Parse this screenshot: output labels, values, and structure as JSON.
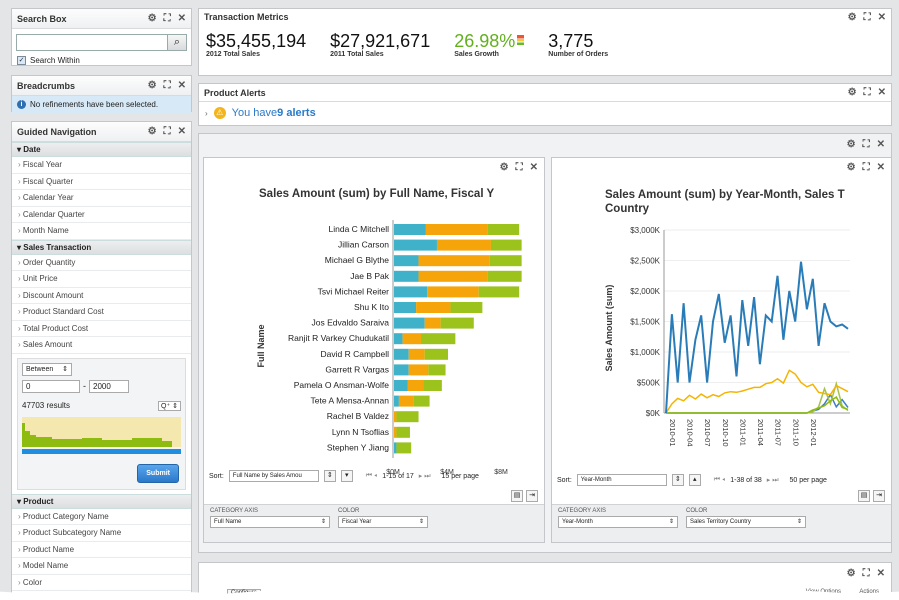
{
  "search": {
    "title": "Search Box",
    "within_label": "Search Within"
  },
  "breadcrumbs": {
    "title": "Breadcrumbs",
    "message": "No refinements have been selected."
  },
  "guided": {
    "title": "Guided Navigation",
    "date_label": "Date",
    "date_items": [
      "Fiscal Year",
      "Fiscal Quarter",
      "Calendar Year",
      "Calendar Quarter",
      "Month Name"
    ],
    "sales_label": "Sales Transaction",
    "sales_items": [
      "Order Quantity",
      "Unit Price",
      "Discount Amount",
      "Product Standard Cost",
      "Total Product Cost",
      "Sales Amount"
    ],
    "range_op": "Between",
    "range_from": "0",
    "range_to": "2000",
    "results": "47703 results",
    "submit": "Submit",
    "product_label": "Product",
    "product_items": [
      "Product Category Name",
      "Product Subcategory Name",
      "Product Name",
      "Model Name",
      "Color"
    ]
  },
  "metrics": {
    "title": "Transaction Metrics",
    "items": [
      {
        "value": "$35,455,194",
        "label": "2012 Total Sales"
      },
      {
        "value": "$27,921,671",
        "label": "2011 Total Sales"
      },
      {
        "value": "26.98%",
        "label": "Sales Growth"
      },
      {
        "value": "3,775",
        "label": "Number of Orders"
      }
    ]
  },
  "alerts": {
    "title": "Product Alerts",
    "prefix": "You have ",
    "count": "9 alerts"
  },
  "bar": {
    "sort_label": "Sort:",
    "sort_value": "Full Name by Sales Amou",
    "pager": "1-15 of 17",
    "per_page": "15 per page",
    "cat_axis_label": "CATEGORY AXIS",
    "cat_axis_value": "Full Name",
    "color_label": "COLOR",
    "color_value": "Fiscal Year"
  },
  "line": {
    "sort_label": "Sort:",
    "sort_value": "Year-Month",
    "pager": "1-38 of 38",
    "per_page": "50 per page",
    "cat_axis_label": "CATEGORY AXIS",
    "cat_axis_value": "Year-Month",
    "color_label": "COLOR",
    "color_value": "Sales Territory Country"
  },
  "bottom": {
    "tab": "Configure",
    "right": "View Options",
    "actions": "Actions"
  },
  "colors": {
    "teal": "#3fb1c9",
    "orange": "#f5a50a",
    "green": "#9bc31c",
    "blue": "#2a7cb8",
    "link": "#2a7ac8",
    "growth": "#62b01e"
  },
  "chart_data": [
    {
      "type": "bar",
      "title": "Sales Amount (sum) by Full Name, Fiscal Y",
      "ylabel": "Full Name",
      "orientation": "horizontal",
      "stacked": true,
      "categories": [
        "Linda C Mitchell",
        "Jillian  Carson",
        "Michael G Blythe",
        "Jae B Pak",
        "Tsvi Michael Reiter",
        "Shu K Ito",
        "Jos Edvaldo Saraiva",
        "Ranjit R Varkey Chudukatil",
        "David R Campbell",
        "Garrett R Vargas",
        "Pamela O Ansman-Wolfe",
        "Tete A Mensa-Annan",
        "Rachel B Valdez",
        "Lynn N Tsoflias",
        "Stephen Y Jiang"
      ],
      "series": [
        {
          "values": [
            1.3,
            1.75,
            1.0,
            1.0,
            1.35,
            0.9,
            1.25,
            0.35,
            0.6,
            0.6,
            0.55,
            0.2,
            0,
            0,
            0.1
          ]
        },
        {
          "values": [
            2.5,
            2.2,
            2.9,
            2.8,
            2.1,
            1.4,
            0.65,
            0.75,
            0.65,
            0.8,
            0.65,
            0.6,
            0.1,
            0.1,
            0
          ]
        },
        {
          "values": [
            1.3,
            1.25,
            1.3,
            1.4,
            1.65,
            1.3,
            1.35,
            1.4,
            0.95,
            0.7,
            0.75,
            0.65,
            0.9,
            0.55,
            0.6
          ]
        }
      ],
      "xticks": [
        "$0M",
        "$4M",
        "$8M"
      ],
      "xlim": [
        0,
        9
      ]
    },
    {
      "type": "line",
      "title": "Sales Amount (sum) by Year-Month, Sales T Country",
      "ylabel": "Sales Amount (sum)",
      "yticks": [
        "$0K",
        "$500K",
        "$1,000K",
        "$1,500K",
        "$2,000K",
        "$2,500K",
        "$3,000K"
      ],
      "ylim": [
        0,
        3000
      ],
      "xticks": [
        "2010-01",
        "2010-04",
        "2010-07",
        "2010-10",
        "2011-01",
        "2011-04",
        "2011-07",
        "2011-10",
        "2012-01"
      ],
      "series": [
        {
          "values": [
            0,
            1620,
            500,
            1800,
            500,
            1200,
            1600,
            500,
            1500,
            1950,
            1150,
            1600,
            600,
            1850,
            1100,
            1900,
            800,
            1600,
            1500,
            2250,
            1200,
            2000,
            1500,
            2480,
            1700,
            2200,
            1100,
            1800,
            1500,
            1420,
            1450,
            1380
          ]
        },
        {
          "values": [
            0,
            150,
            240,
            200,
            290,
            230,
            310,
            250,
            300,
            270,
            330,
            350,
            340,
            360,
            390,
            420,
            420,
            480,
            500,
            560,
            490,
            700,
            640,
            500,
            430,
            470,
            340,
            320,
            300,
            450,
            400,
            350
          ]
        },
        {
          "values": [
            0,
            0,
            0,
            0,
            0,
            0,
            0,
            0,
            0,
            0,
            0,
            0,
            0,
            0,
            0,
            0,
            0,
            0,
            0,
            0,
            0,
            0,
            0,
            0,
            0,
            50,
            80,
            120,
            200,
            260,
            90,
            60
          ]
        },
        {
          "values": [
            0,
            0,
            0,
            0,
            0,
            0,
            0,
            0,
            0,
            0,
            0,
            0,
            0,
            0,
            0,
            0,
            0,
            0,
            0,
            0,
            0,
            0,
            0,
            0,
            0,
            20,
            100,
            400,
            150,
            480,
            120,
            40
          ]
        },
        {
          "values": [
            0,
            0,
            0,
            0,
            0,
            0,
            0,
            0,
            0,
            0,
            0,
            0,
            0,
            0,
            0,
            0,
            0,
            0,
            0,
            0,
            0,
            0,
            0,
            0,
            0,
            30,
            60,
            150,
            300,
            100,
            220,
            90
          ]
        }
      ]
    }
  ]
}
